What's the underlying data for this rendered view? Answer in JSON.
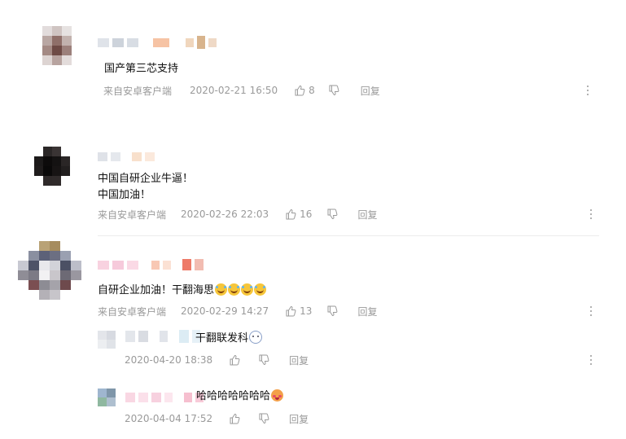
{
  "comments": [
    {
      "text_lines": [
        "国产第三芯支持"
      ],
      "source": "来自安卓客户端",
      "time": "2020-02-21 16:50",
      "likes": "8",
      "reply_label": "回复"
    },
    {
      "text_lines": [
        "中国自研企业牛逼！",
        "中国加油！"
      ],
      "source": "来自安卓客户端",
      "time": "2020-02-26 22:03",
      "likes": "16",
      "reply_label": "回复"
    },
    {
      "text_lines": [
        "自研企业加油！干翻海思"
      ],
      "source": "来自安卓客户端",
      "time": "2020-02-29 14:27",
      "likes": "13",
      "reply_label": "回复",
      "replies": [
        {
          "text": "干翻联发科",
          "time": "2020-04-20 18:38",
          "reply_label": "回复"
        },
        {
          "text": "哈哈哈哈哈哈哈",
          "time": "2020-04-04 17:52",
          "reply_label": "回复"
        }
      ]
    }
  ],
  "icons": {
    "like": "thumbs-up-icon",
    "dislike": "thumbs-down-icon",
    "more": "more-vertical-icon",
    "emoji_laugh": "tears-of-joy-emoji",
    "emoji_bunny": "bunny-emoji",
    "emoji_blush": "blush-emoji"
  },
  "colors": {
    "meta": "#9a9a9a",
    "text": "#111111",
    "divider": "#ececec"
  }
}
